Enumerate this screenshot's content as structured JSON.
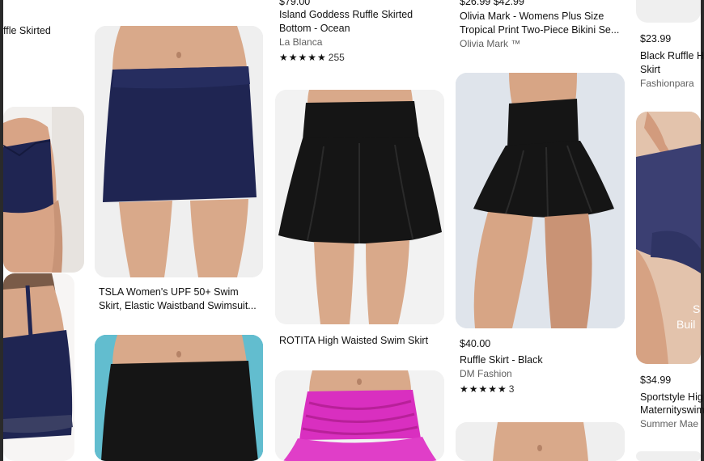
{
  "products": [
    {
      "id": "left-top-title",
      "title": "ffle Skirted"
    },
    {
      "id": "tsla",
      "title_line1": "TSLA Women's UPF 50+ Swim",
      "title_line2": "Skirt, Elastic Waistband Swimsuit..."
    },
    {
      "id": "island",
      "price": "$79.00",
      "title_line1": "Island Goddess Ruffle Skirted",
      "title_line2": "Bottom - Ocean",
      "brand": "La Blanca",
      "rating_count": "255"
    },
    {
      "id": "rotita",
      "title": "ROTITA High Waisted Swim Skirt"
    },
    {
      "id": "olivia",
      "price": "$26.99 $42.99",
      "title_line1": "Olivia Mark - Womens Plus Size",
      "title_line2": "Tropical Print Two-Piece Bikini Se...",
      "brand": "Olivia Mark ™"
    },
    {
      "id": "ruffle",
      "price": "$40.00",
      "title": "Ruffle Skirt - Black",
      "brand": "DM Fashion",
      "rating_count": "3"
    },
    {
      "id": "black-ruffle",
      "price": "$23.99",
      "title_line1": "Black Ruffle Hi",
      "title_line2": "Skirt",
      "brand": "Fashionpara"
    },
    {
      "id": "sportstyle",
      "price": "$34.99",
      "title_line1": "Sportstyle Hig",
      "title_line2": "Maternityswim",
      "brand": "Summer Mae"
    }
  ],
  "overlay_text": {
    "line1": "S",
    "line2": "Buil"
  },
  "colors": {
    "navy": "#1f2552",
    "black": "#151515",
    "magenta": "#d92fc0",
    "skin": "#d9a98a",
    "pool": "#4fb3c9"
  }
}
